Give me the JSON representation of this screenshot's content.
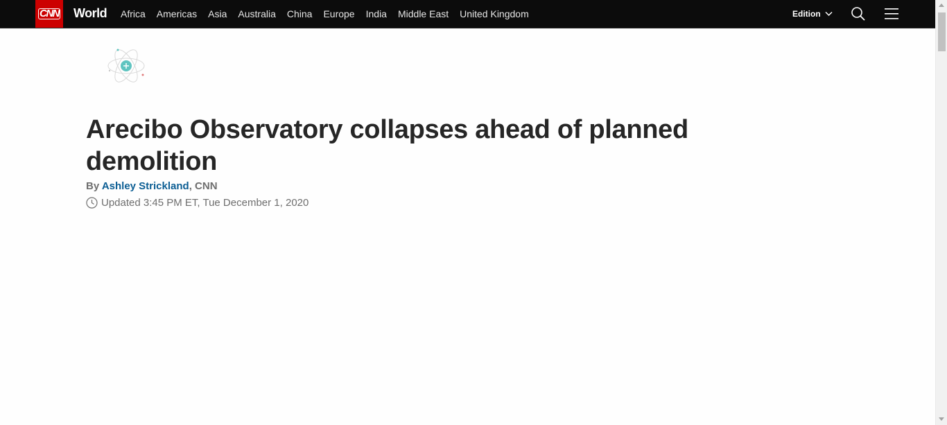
{
  "header": {
    "logo_text": "CNN",
    "section_title": "World",
    "nav_items": [
      "Africa",
      "Americas",
      "Asia",
      "Australia",
      "China",
      "Europe",
      "India",
      "Middle East",
      "United Kingdom"
    ],
    "edition_label": "Edition",
    "search_icon": "search-icon",
    "menu_icon": "menu-icon",
    "colors": {
      "bar": "#0c0c0c",
      "logo_bg": "#cc0000"
    }
  },
  "article": {
    "headline": "Arecibo Observatory collapses ahead of planned demolition",
    "byline_prefix": "By",
    "author": "Ashley Strickland",
    "source": ", CNN",
    "timestamp": "Updated 3:45 PM ET, Tue December 1, 2020",
    "badge_icon": "atom-icon",
    "colors": {
      "author_link": "#0c5e94",
      "badge_accent": "#5fc4c0"
    }
  }
}
